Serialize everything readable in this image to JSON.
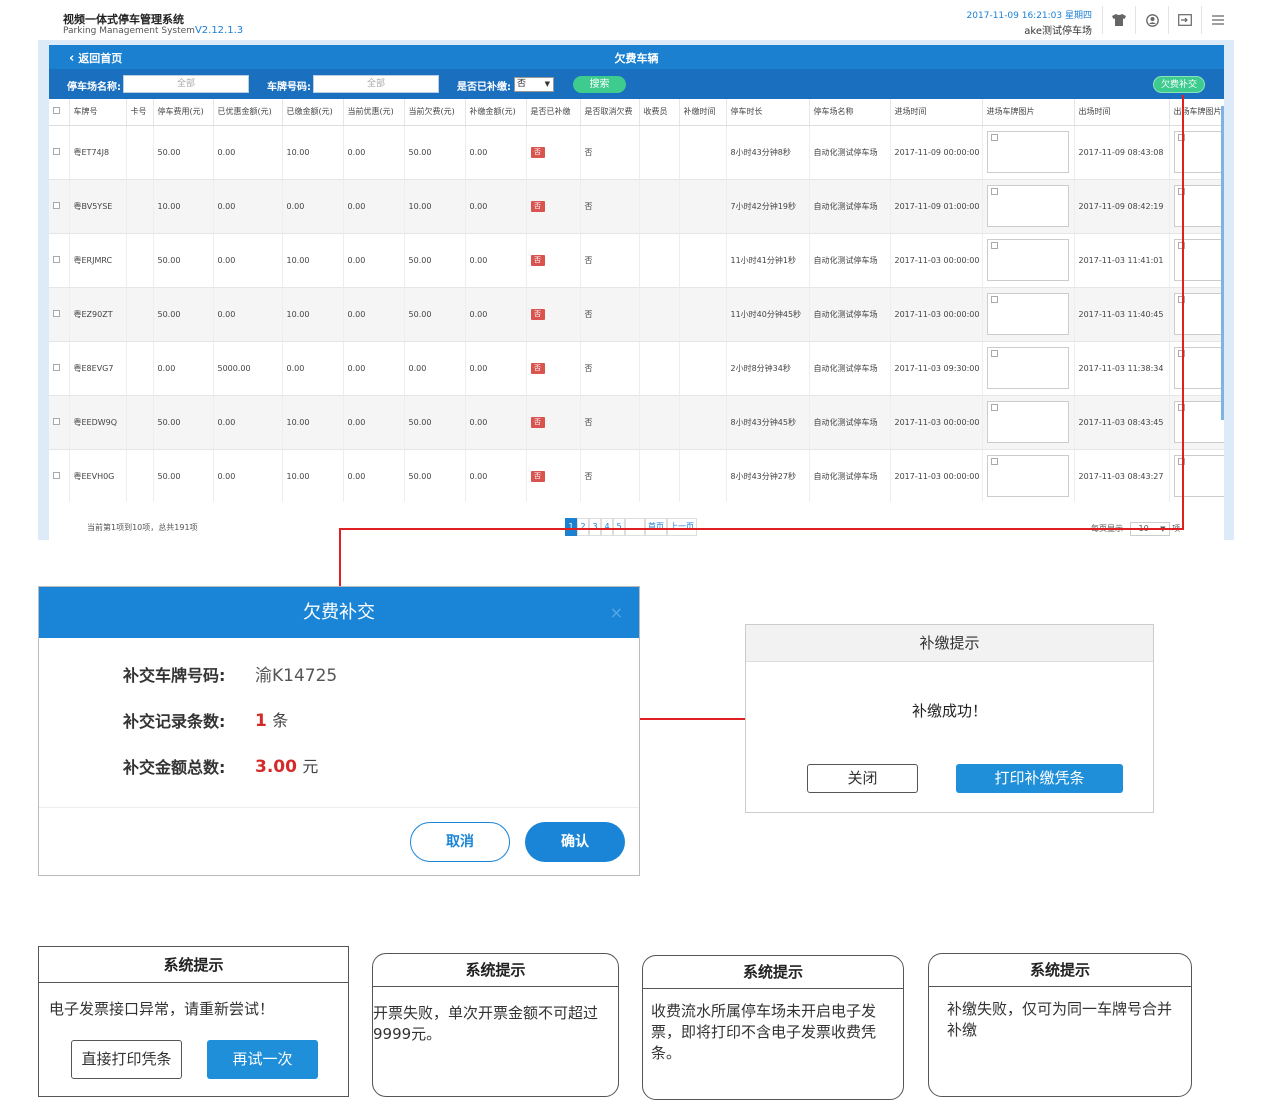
{
  "header": {
    "title": "视频一体式停车管理系统",
    "subtitle": "Parking Management System",
    "version": "V2.12.1.3",
    "datetime": "2017-11-09 16:21:03 星期四",
    "lot_name": "ake测试停车场",
    "icons": [
      "shirt-icon",
      "user-icon",
      "logout-icon",
      "menu-icon"
    ]
  },
  "titlebar": {
    "back": "返回首页",
    "title": "欠费车辆"
  },
  "filters": {
    "lot_label": "停车场名称:",
    "lot_placeholder": "全部",
    "plate_label": "车牌号码:",
    "plate_placeholder": "全部",
    "paid_label": "是否已补缴:",
    "paid_value": "否",
    "search": "搜索",
    "arrears_pay": "欠费补交"
  },
  "table": {
    "columns": [
      "",
      "车牌号",
      "卡号",
      "停车费用(元)",
      "已优惠金额(元)",
      "已缴金额(元)",
      "当前优惠(元)",
      "当前欠费(元)",
      "补缴金额(元)",
      "是否已补缴",
      "是否取消欠费",
      "收费员",
      "补缴时间",
      "停车时长",
      "停车场名称",
      "进场时间",
      "进场车牌图片",
      "出场时间",
      "出场车牌图片"
    ],
    "rows": [
      {
        "plate": "粤ET74J8",
        "card": "",
        "fee": "50.00",
        "disc": "0.00",
        "paid": "10.00",
        "cur_disc": "0.00",
        "owe": "50.00",
        "repay": "0.00",
        "is_paid": "否",
        "cancel": "否",
        "cashier": "",
        "repay_time": "",
        "duration": "8小时43分钟8秒",
        "lot": "自动化测试停车场",
        "in_time": "2017-11-09 00:00:00",
        "out_time": "2017-11-09 08:43:08"
      },
      {
        "plate": "粤BV5YSE",
        "card": "",
        "fee": "10.00",
        "disc": "0.00",
        "paid": "0.00",
        "cur_disc": "0.00",
        "owe": "10.00",
        "repay": "0.00",
        "is_paid": "否",
        "cancel": "否",
        "cashier": "",
        "repay_time": "",
        "duration": "7小时42分钟19秒",
        "lot": "自动化测试停车场",
        "in_time": "2017-11-09 01:00:00",
        "out_time": "2017-11-09 08:42:19"
      },
      {
        "plate": "粤ERJMRC",
        "card": "",
        "fee": "50.00",
        "disc": "0.00",
        "paid": "10.00",
        "cur_disc": "0.00",
        "owe": "50.00",
        "repay": "0.00",
        "is_paid": "否",
        "cancel": "否",
        "cashier": "",
        "repay_time": "",
        "duration": "11小时41分钟1秒",
        "lot": "自动化测试停车场",
        "in_time": "2017-11-03 00:00:00",
        "out_time": "2017-11-03 11:41:01"
      },
      {
        "plate": "粤EZ90ZT",
        "card": "",
        "fee": "50.00",
        "disc": "0.00",
        "paid": "10.00",
        "cur_disc": "0.00",
        "owe": "50.00",
        "repay": "0.00",
        "is_paid": "否",
        "cancel": "否",
        "cashier": "",
        "repay_time": "",
        "duration": "11小时40分钟45秒",
        "lot": "自动化测试停车场",
        "in_time": "2017-11-03 00:00:00",
        "out_time": "2017-11-03 11:40:45"
      },
      {
        "plate": "粤E8EVG7",
        "card": "",
        "fee": "0.00",
        "disc": "5000.00",
        "paid": "0.00",
        "cur_disc": "0.00",
        "owe": "0.00",
        "repay": "0.00",
        "is_paid": "否",
        "cancel": "否",
        "cashier": "",
        "repay_time": "",
        "duration": "2小时8分钟34秒",
        "lot": "自动化测试停车场",
        "in_time": "2017-11-03 09:30:00",
        "out_time": "2017-11-03 11:38:34"
      },
      {
        "plate": "粤EEDW9Q",
        "card": "",
        "fee": "50.00",
        "disc": "0.00",
        "paid": "10.00",
        "cur_disc": "0.00",
        "owe": "50.00",
        "repay": "0.00",
        "is_paid": "否",
        "cancel": "否",
        "cashier": "",
        "repay_time": "",
        "duration": "8小时43分钟45秒",
        "lot": "自动化测试停车场",
        "in_time": "2017-11-03 00:00:00",
        "out_time": "2017-11-03 08:43:45"
      },
      {
        "plate": "粤EEVH0G",
        "card": "",
        "fee": "50.00",
        "disc": "0.00",
        "paid": "10.00",
        "cur_disc": "0.00",
        "owe": "50.00",
        "repay": "0.00",
        "is_paid": "否",
        "cancel": "否",
        "cashier": "",
        "repay_time": "",
        "duration": "8小时43分钟27秒",
        "lot": "自动化测试停车场",
        "in_time": "2017-11-03 00:00:00",
        "out_time": "2017-11-03 08:43:27"
      }
    ]
  },
  "pager": {
    "info": "当前第1项到10项，总共191项",
    "pages": [
      "1",
      "2",
      "3",
      "4",
      "5"
    ],
    "current": "1",
    "first": "首页",
    "prev": "上一页",
    "per_page_label": "每页显示",
    "per_page": "10",
    "per_page_suffix": "项"
  },
  "pay_dialog": {
    "title": "欠费补交",
    "close": "×",
    "plate_label": "补交车牌号码:",
    "plate_value": "渝K14725",
    "count_label": "补交记录条数:",
    "count_value": "1",
    "count_unit": "条",
    "total_label": "补交金额总数:",
    "total_value": "3.00",
    "total_unit": "元",
    "cancel": "取消",
    "confirm": "确认"
  },
  "success_dialog": {
    "title": "补缴提示",
    "message": "补缴成功！",
    "close": "关闭",
    "print": "打印补缴凭条"
  },
  "tips": [
    {
      "title": "系统提示",
      "message": "电子发票接口异常，请重新尝试！",
      "btn1": "直接打印凭条",
      "btn2": "再试一次"
    },
    {
      "title": "系统提示",
      "message": "开票失败，单次开票金额不可超过9999元。"
    },
    {
      "title": "系统提示",
      "message": "收费流水所属停车场未开启电子发票，即将打印不含电子发票收费凭条。"
    },
    {
      "title": "系统提示",
      "message": "补缴失败，仅可为同一车牌号合并补缴"
    }
  ],
  "colors": {
    "primary": "#1a80cf",
    "accent_green": "#3ecb8e",
    "danger": "#d9534f",
    "connector": "#e02020"
  }
}
